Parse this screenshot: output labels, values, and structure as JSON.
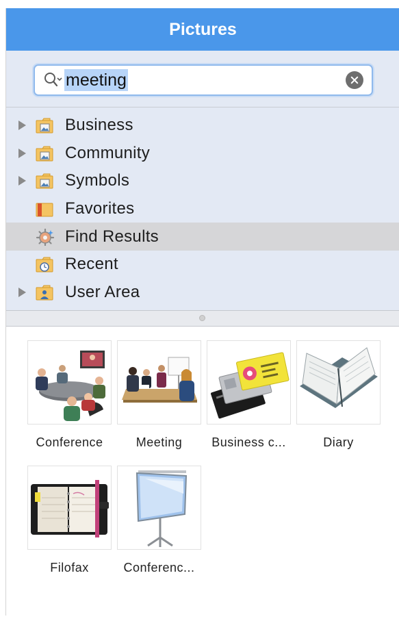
{
  "panel": {
    "title": "Pictures"
  },
  "search": {
    "value": "meeting"
  },
  "tree": {
    "items": [
      {
        "label": "Business",
        "icon": "picture-folder-icon",
        "expandable": true
      },
      {
        "label": "Community",
        "icon": "picture-folder-icon",
        "expandable": true
      },
      {
        "label": "Symbols",
        "icon": "picture-folder-icon",
        "expandable": true
      },
      {
        "label": "Favorites",
        "icon": "favorites-folder-icon",
        "expandable": false
      },
      {
        "label": "Find Results",
        "icon": "find-results-icon",
        "expandable": false,
        "selected": true
      },
      {
        "label": "Recent",
        "icon": "recent-folder-icon",
        "expandable": false
      },
      {
        "label": "User Area",
        "icon": "user-folder-icon",
        "expandable": true
      }
    ]
  },
  "gallery": {
    "items": [
      {
        "label": "Conference",
        "thumbnail": "conference-thumbnail"
      },
      {
        "label": "Meeting",
        "thumbnail": "meeting-thumbnail"
      },
      {
        "label": "Business c...",
        "thumbnail": "business-cards-thumbnail"
      },
      {
        "label": "Diary",
        "thumbnail": "diary-thumbnail"
      },
      {
        "label": "Filofax",
        "thumbnail": "filofax-thumbnail"
      },
      {
        "label": "Conferenc...",
        "thumbnail": "conference-screen-thumbnail"
      }
    ]
  },
  "colors": {
    "title_bar": "#4a97ea",
    "tree_background": "#e3e9f4",
    "selection": "#d6d6d8",
    "search_highlight": "#b7d4f8"
  }
}
